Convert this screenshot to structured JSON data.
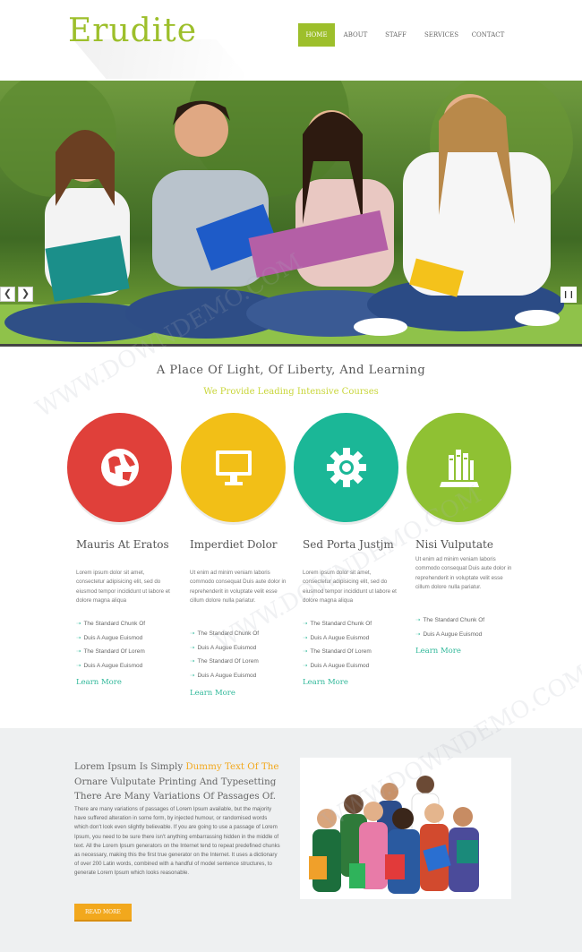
{
  "brand": {
    "logo": "Erudite",
    "accent": "#9dbf2b"
  },
  "nav": {
    "items": [
      "HOME",
      "ABOUT",
      "STAFF",
      "SERVICES",
      "CONTACT"
    ]
  },
  "slider": {
    "prev_icon": "chevron-left-icon",
    "next_icon": "chevron-right-icon",
    "pause_icon": "pause-icon"
  },
  "intro": {
    "title": "A Place Of Light, Of Liberty, And Learning",
    "subtitle": "We Provide Leading Intensive Courses"
  },
  "features": [
    {
      "color": "#e0403a",
      "icon": "globe-icon",
      "title": "Mauris At Eratos",
      "body": "Lorem ipsum dolor sit amet, consectetur adipisicing elit, sed do eiusmod tempor incididunt ut labore et dolore magna aliqua",
      "items": [
        "The Standard Chunk Of",
        "Duis A Augue Euismod",
        "The Standard Of Lorem",
        "Duis A Augue Euismod"
      ],
      "link": "Learn More"
    },
    {
      "color": "#f2bf17",
      "icon": "monitor-icon",
      "title": "Imperdiet Dolor",
      "body": "Ut enim ad minim veniam laboris commodo consequat Duis aute dolor in reprehenderit in voluptate velit esse cillum dolore nulla pariatur.",
      "items": [
        "The Standard Chunk Of",
        "Duis A Augue Euismod",
        "The Standard Of Lorem",
        "Duis A Augue Euismod"
      ],
      "link": "Learn More"
    },
    {
      "color": "#1bb797",
      "icon": "gear-icon",
      "title": "Sed Porta Justjm",
      "body": "Lorem ipsum dolor sit amet, consectetur adipisicing elit, sed do eiusmod tempor incididunt ut labore et dolore magna aliqua",
      "items": [
        "The Standard Chunk Of",
        "Duis A Augue Euismod",
        "The Standard Of Lorem",
        "Duis A Augue Euismod"
      ],
      "link": "Learn More"
    },
    {
      "color": "#8fc133",
      "icon": "books-icon",
      "title": "Nisi Vulputate",
      "body": "Ut enim ad minim veniam laboris commodo consequat Duis aute dolor in reprehenderit in voluptate velit esse cillum dolore nulla pariatur.",
      "items": [
        "The Standard Chunk Of",
        "Duis A Augue Euismod"
      ],
      "link": "Learn More"
    }
  ],
  "about": {
    "title_pre": "Lorem Ipsum Is Simply ",
    "title_hl": "Dummy Text Of The",
    "title_post": " Ornare Vulputate Printing And Typesetting There Are Many Variations Of Passages Of.",
    "body": "There are many variations of passages of Lorem Ipsum available, but the majority have suffered alteration in some form, by injected humour, or randomised words which don't look even slightly believable. If you are going to use a passage of Lorem Ipsum, you need to be sure there isn't anything embarrassing hidden in the middle of text. All the Lorem Ipsum generators on the Internet tend to repeat predefined chunks as necessary, making this the first true generator on the Internet. It uses a dictionary of over 200 Latin words, combined with a handful of model sentence structures, to generate Lorem Ipsum which looks reasonable.",
    "button": "READ MORE",
    "highlight_color": "#f2a81d"
  }
}
